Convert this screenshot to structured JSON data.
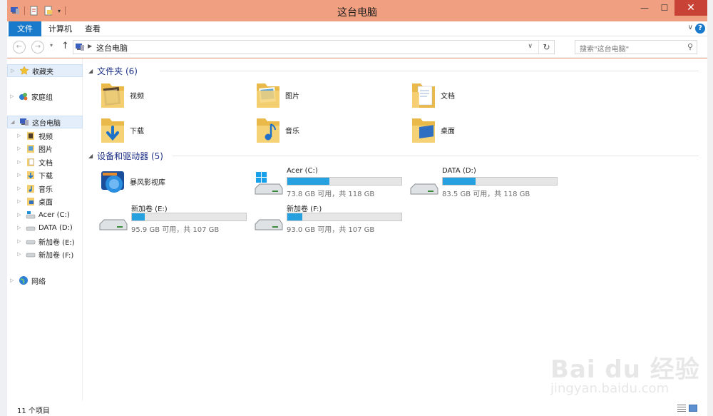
{
  "window": {
    "title": "这台电脑",
    "controls": {
      "minimize": "—",
      "maximize": "☐",
      "close": "✕"
    }
  },
  "ribbon": {
    "tabs": [
      {
        "label": "文件",
        "active": true
      },
      {
        "label": "计算机"
      },
      {
        "label": "查看"
      }
    ],
    "help": "?"
  },
  "address": {
    "path": "这台电脑",
    "search_placeholder": "搜索\"这台电脑\""
  },
  "nav": {
    "favorites": "收藏夹",
    "homegroup": "家庭组",
    "this_pc": "这台电脑",
    "children": [
      "视频",
      "图片",
      "文档",
      "下载",
      "音乐",
      "桌面",
      "Acer (C:)",
      "DATA (D:)",
      "新加卷 (E:)",
      "新加卷 (F:)"
    ],
    "network": "网络"
  },
  "folders": {
    "title": "文件夹 (6)",
    "items": [
      "视频",
      "图片",
      "文档",
      "下载",
      "音乐",
      "桌面"
    ]
  },
  "devices": {
    "title": "设备和驱动器 (5)",
    "app": "暴风影视库",
    "drives": [
      {
        "name": "Acer (C:)",
        "info": "73.8 GB 可用，共 118 GB",
        "used_fraction": 0.37
      },
      {
        "name": "DATA (D:)",
        "info": "83.5 GB 可用，共 118 GB",
        "used_fraction": 0.29
      },
      {
        "name": "新加卷 (E:)",
        "info": "95.9 GB 可用，共 107 GB",
        "used_fraction": 0.11
      },
      {
        "name": "新加卷 (F:)",
        "info": "93.0 GB 可用，共 107 GB",
        "used_fraction": 0.13
      }
    ]
  },
  "status": {
    "count": "11 个项目"
  },
  "watermark": {
    "brand": "Bai du 经验",
    "site": "jingyan.baidu.com"
  },
  "colors": {
    "accent": "#1979ca",
    "titlebar": "#f0a080",
    "drive_fill": "#27a0e0",
    "close": "#c94236"
  }
}
